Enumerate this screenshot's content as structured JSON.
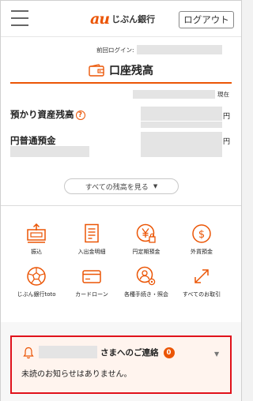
{
  "header": {
    "logo_au": "au",
    "logo_bank": "じぶん銀行",
    "logout_label": "ログアウト"
  },
  "last_login": {
    "label": "前回ログイン:"
  },
  "balance_section": {
    "title": "口座残高",
    "as_of_suffix": "現在",
    "rows": [
      {
        "label": "預かり資産残高",
        "currency": "円"
      },
      {
        "label": "円普通預金",
        "currency": "円"
      }
    ],
    "show_all_label": "すべての残高を見る",
    "show_all_caret": "▼"
  },
  "menu": [
    {
      "label": "振込",
      "icon": "transfer-icon"
    },
    {
      "label": "入出金明細",
      "icon": "statement-icon"
    },
    {
      "label": "円定期預金",
      "icon": "yen-deposit-icon"
    },
    {
      "label": "外貨預金",
      "icon": "dollar-icon"
    },
    {
      "label": "じぶん銀行toto",
      "icon": "soccer-ball-icon"
    },
    {
      "label": "カードローン",
      "icon": "card-icon"
    },
    {
      "label": "各種手続き・照会",
      "icon": "person-gear-icon"
    },
    {
      "label": "すべてのお取引",
      "icon": "arrows-icon"
    }
  ],
  "notice": {
    "title": "さまへのご連絡",
    "count": "0",
    "caret": "▼",
    "body": "未読のお知らせはありません。"
  },
  "colors": {
    "accent": "#eb5505",
    "highlight_border": "#e0121b"
  }
}
